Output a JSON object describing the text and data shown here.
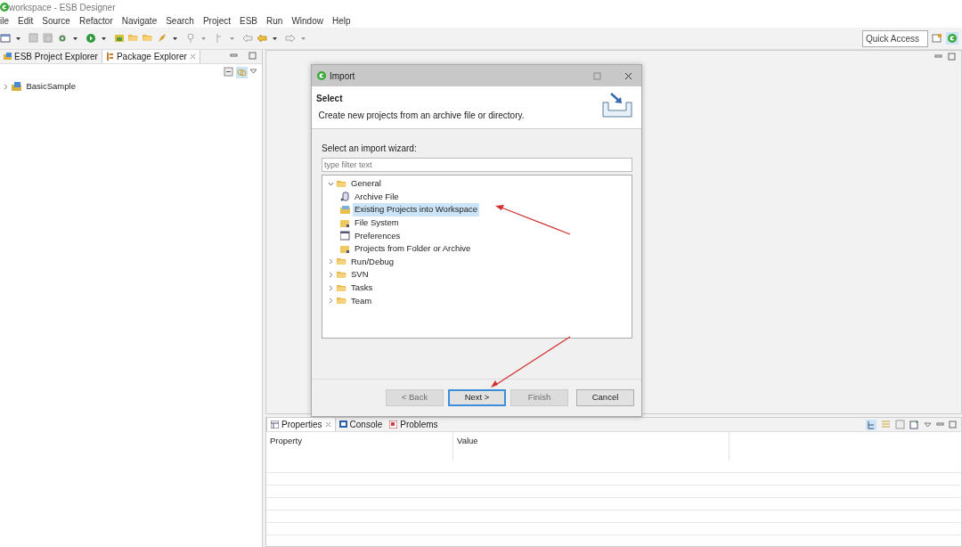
{
  "window": {
    "title": "workspace - ESB Designer"
  },
  "menu": [
    "ile",
    "Edit",
    "Source",
    "Refactor",
    "Navigate",
    "Search",
    "Project",
    "ESB",
    "Run",
    "Window",
    "Help"
  ],
  "quick_access": {
    "placeholder": "Quick Access"
  },
  "left_panel": {
    "tabs": [
      {
        "label": "ESB Project Explorer",
        "selected": false
      },
      {
        "label": "Package Explorer",
        "selected": true
      }
    ],
    "tree": [
      {
        "label": "BasicSample",
        "expanded": false
      }
    ]
  },
  "dialog": {
    "title": "Import",
    "header_title": "Select",
    "header_description": "Create new projects from an archive file or directory.",
    "wizard_label": "Select an import wizard:",
    "filter": {
      "placeholder": "type filter text"
    },
    "tree": [
      {
        "label": "General",
        "kind": "folder",
        "expanded": true,
        "selected": false,
        "children": [
          {
            "label": "Archive File",
            "kind": "archive",
            "selected": false
          },
          {
            "label": "Existing Projects into Workspace",
            "kind": "project",
            "selected": true
          },
          {
            "label": "File System",
            "kind": "filesystem",
            "selected": false
          },
          {
            "label": "Preferences",
            "kind": "preferences",
            "selected": false
          },
          {
            "label": "Projects from Folder or Archive",
            "kind": "filesystem",
            "selected": false
          }
        ]
      },
      {
        "label": "Run/Debug",
        "kind": "folder",
        "expanded": false,
        "selected": false
      },
      {
        "label": "SVN",
        "kind": "folder",
        "expanded": false,
        "selected": false
      },
      {
        "label": "Tasks",
        "kind": "folder",
        "expanded": false,
        "selected": false
      },
      {
        "label": "Team",
        "kind": "folder",
        "expanded": false,
        "selected": false
      }
    ],
    "buttons": [
      {
        "label": "< Back",
        "disabled": true,
        "default": false
      },
      {
        "label": "Next >",
        "disabled": false,
        "default": true
      },
      {
        "label": "Finish",
        "disabled": true,
        "default": false
      },
      {
        "label": "Cancel",
        "disabled": false,
        "default": false
      }
    ]
  },
  "bottom_panel": {
    "tabs": [
      {
        "label": "Properties",
        "selected": true
      },
      {
        "label": "Console",
        "selected": false
      },
      {
        "label": "Problems",
        "selected": false
      }
    ],
    "table": {
      "columns": [
        "Property",
        "Value"
      ]
    }
  }
}
